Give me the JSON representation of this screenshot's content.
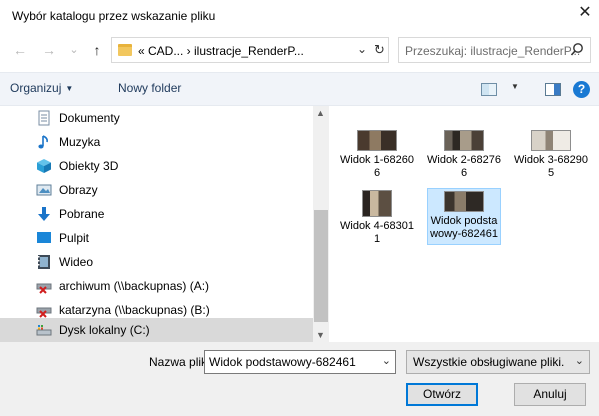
{
  "window": {
    "title": "Wybór katalogu przez wskazanie pliku",
    "close_glyph": "✕"
  },
  "address": {
    "back_glyph": "←",
    "forward_glyph": "→",
    "history_glyph": "⌄",
    "up_glyph": "↑",
    "path": "« CAD... › ilustracje_RenderP...",
    "dropdown_glyph": "⌄",
    "refresh_glyph": "↻",
    "search_placeholder": "Przeszukaj: ilustracje_RenderP..."
  },
  "toolbar": {
    "organize_label": "Organizuj",
    "organize_arrow": "▼",
    "new_folder_label": "Nowy folder",
    "view_arrow": "▼",
    "help_glyph": "?"
  },
  "nav": {
    "items": [
      {
        "label": "Dokumenty",
        "icon": "documents-icon"
      },
      {
        "label": "Muzyka",
        "icon": "music-icon"
      },
      {
        "label": "Obiekty 3D",
        "icon": "3d-objects-icon"
      },
      {
        "label": "Obrazy",
        "icon": "pictures-icon"
      },
      {
        "label": "Pobrane",
        "icon": "downloads-icon"
      },
      {
        "label": "Pulpit",
        "icon": "desktop-icon"
      },
      {
        "label": "Wideo",
        "icon": "video-icon"
      },
      {
        "label": "archiwum (\\\\backupnas) (A:)",
        "icon": "network-drive-disconnected-icon"
      },
      {
        "label": "katarzyna (\\\\backupnas) (B:)",
        "icon": "network-drive-disconnected-icon"
      },
      {
        "label": "Dysk lokalny (C:)",
        "icon": "local-disk-icon",
        "selected": true
      }
    ],
    "scroll_up_glyph": "▲",
    "scroll_down_glyph": "▼"
  },
  "files": [
    {
      "label": "Widok 1-682606"
    },
    {
      "label": "Widok 2-682766"
    },
    {
      "label": "Widok 3-682905"
    },
    {
      "label": "Widok 4-683011"
    },
    {
      "label": "Widok podstawowy-682461",
      "selected": true
    }
  ],
  "bottom": {
    "filename_label": "Nazwa pliku:",
    "filename_value": "Widok podstawowy-682461",
    "filetype_value": "Wszystkie obsługiwane pliki.",
    "dropdown_glyph": "⌄",
    "open_label": "Otwórz",
    "cancel_label": "Anuluj"
  },
  "colors": {
    "accent": "#0078d7",
    "selection": "#cce8ff",
    "toolbar_bg": "#f1f4f9",
    "help": "#1979d3"
  }
}
